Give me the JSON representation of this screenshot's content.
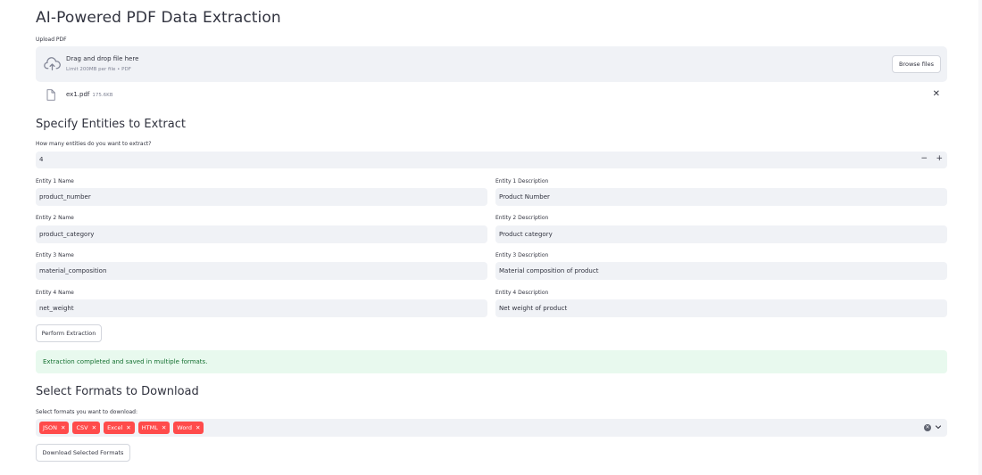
{
  "page": {
    "title": "AI-Powered PDF Data Extraction"
  },
  "upload": {
    "label": "Upload PDF",
    "drop_text": "Drag and drop file here",
    "limit_text": "Limit 200MB per file • PDF",
    "browse_label": "Browse files",
    "file_name": "ex1.pdf",
    "file_size": "175.6KB",
    "close_glyph": "✕"
  },
  "entities": {
    "heading": "Specify Entities to Extract",
    "count_label": "How many entities do you want to extract?",
    "count_value": "4",
    "minus": "−",
    "plus": "+",
    "items": [
      {
        "name_label": "Entity 1 Name",
        "name_value": "product_number",
        "desc_label": "Entity 1 Description",
        "desc_value": "Product Number"
      },
      {
        "name_label": "Entity 2 Name",
        "name_value": "product_category",
        "desc_label": "Entity 2 Description",
        "desc_value": "Product category"
      },
      {
        "name_label": "Entity 3 Name",
        "name_value": "material_composition",
        "desc_label": "Entity 3 Description",
        "desc_value": "Material composition of product"
      },
      {
        "name_label": "Entity 4 Name",
        "name_value": "net_weight",
        "desc_label": "Entity 4 Description",
        "desc_value": "Net weight of product"
      }
    ],
    "extract_button": "Perform Extraction"
  },
  "status": {
    "success_message": "Extraction completed and saved in multiple formats."
  },
  "download": {
    "heading": "Select Formats to Download",
    "select_label": "Select formats you want to download:",
    "chips": [
      "JSON",
      "CSV",
      "Excel",
      "HTML",
      "Word"
    ],
    "chip_remove": "✕",
    "clear_glyph": "✕",
    "download_button": "Download Selected Formats"
  },
  "colors": {
    "accent": "#ff4b4b",
    "input_bg": "#f0f2f6",
    "success_bg": "#e8f9ee",
    "success_text": "#177233",
    "text": "#31333f"
  },
  "icons": [
    "cloud-upload-icon",
    "file-icon",
    "close-icon",
    "clear-all-icon",
    "chevron-down-icon"
  ]
}
